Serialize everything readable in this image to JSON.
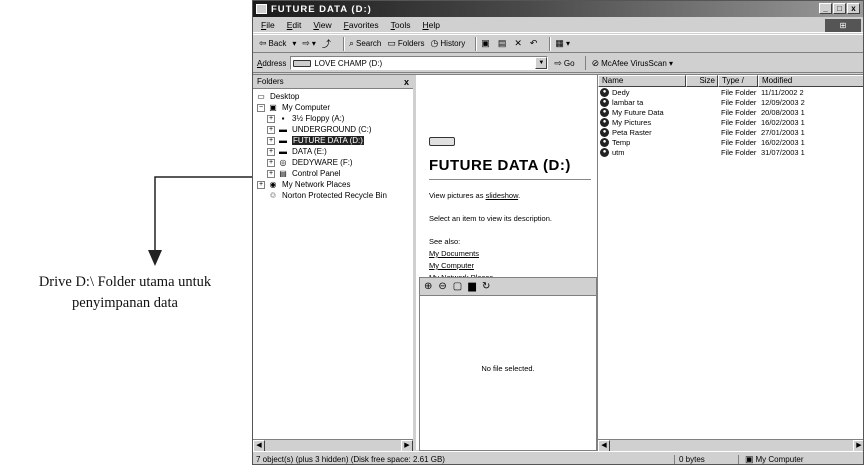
{
  "caption": {
    "line1": "Drive D:\\ Folder utama untuk",
    "line2": "penyimpanan data"
  },
  "window": {
    "title": "FUTURE DATA (D:)",
    "min": "_",
    "max": "□",
    "close": "x"
  },
  "menu": [
    "File",
    "Edit",
    "View",
    "Favorites",
    "Tools",
    "Help"
  ],
  "toolbar": {
    "back": "Back",
    "search": "Search",
    "folders": "Folders",
    "history": "History"
  },
  "address": {
    "label": "Address",
    "value": "LOVE CHAMP (D:)",
    "go": "Go",
    "mcafee": "McAfee VirusScan"
  },
  "folders_pane": {
    "title": "Folders",
    "close": "x",
    "tree": [
      {
        "label": "Desktop",
        "icon": "desktop-icon",
        "level": 0
      },
      {
        "label": "My Computer",
        "icon": "computer-icon",
        "level": 1
      },
      {
        "label": "3½ Floppy (A:)",
        "icon": "floppy-icon",
        "level": 2
      },
      {
        "label": "UNDERGROUND (C:)",
        "icon": "drive-icon",
        "level": 2
      },
      {
        "label": "FUTURE DATA (D:)",
        "icon": "drive-icon",
        "level": 2,
        "selected": true
      },
      {
        "label": "DATA (E:)",
        "icon": "drive-icon",
        "level": 2
      },
      {
        "label": "DEDYWARE (F:)",
        "icon": "cd-drive-icon",
        "level": 2
      },
      {
        "label": "Control Panel",
        "icon": "control-panel-icon",
        "level": 2
      },
      {
        "label": "My Network Places",
        "icon": "network-icon",
        "level": 1
      },
      {
        "label": "Norton Protected Recycle Bin",
        "icon": "recycle-bin-icon",
        "level": 1
      }
    ]
  },
  "info_pane": {
    "title": "FUTURE DATA (D:)",
    "slideshow_prefix": "View pictures as ",
    "slideshow_link": "slideshow",
    "slideshow_suffix": ".",
    "select_text": "Select an item to view its description.",
    "see_also": "See also:",
    "links": [
      "My Documents",
      "My Computer",
      "My Network Places"
    ],
    "no_file": "No file selected."
  },
  "list": {
    "headers": {
      "name": "Name",
      "size": "Size",
      "type": "Type",
      "modified": "Modified"
    },
    "rows": [
      {
        "name": "Dedy",
        "type": "File Folder",
        "modified": "11/11/2002 2"
      },
      {
        "name": "lambar ta",
        "type": "File Folder",
        "modified": "12/09/2003 2"
      },
      {
        "name": "My Future Data",
        "type": "File Folder",
        "modified": "20/08/2003 1"
      },
      {
        "name": "My Pictures",
        "type": "File Folder",
        "modified": "16/02/2003 1"
      },
      {
        "name": "Peta Raster",
        "type": "File Folder",
        "modified": "27/01/2003 1"
      },
      {
        "name": "Temp",
        "type": "File Folder",
        "modified": "16/02/2003 1"
      },
      {
        "name": "utm",
        "type": "File Folder",
        "modified": "31/07/2003 1"
      }
    ]
  },
  "status": {
    "main": "7 object(s) (plus 3 hidden) (Disk free space: 2.61 GB)",
    "size": "0 bytes",
    "zone": "My Computer"
  }
}
